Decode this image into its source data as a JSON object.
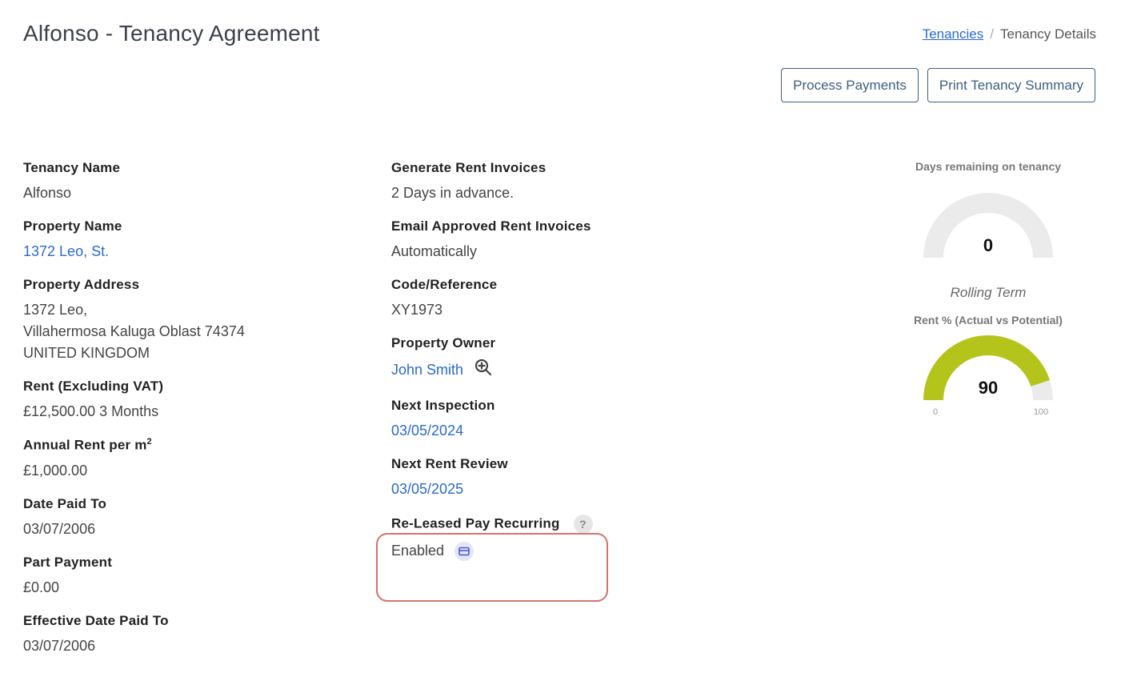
{
  "header": {
    "title": "Alfonso - Tenancy Agreement",
    "breadcrumb": {
      "link": "Tenancies",
      "separator": "/",
      "current": "Tenancy Details"
    }
  },
  "actions": {
    "process_payments": "Process Payments",
    "print_summary": "Print Tenancy Summary"
  },
  "left": {
    "tenancy_name": {
      "label": "Tenancy Name",
      "value": "Alfonso"
    },
    "property_name": {
      "label": "Property Name",
      "value": "1372 Leo, St."
    },
    "property_address": {
      "label": "Property Address",
      "line1": "1372 Leo,",
      "line2": "Villahermosa Kaluga Oblast 74374",
      "line3": "UNITED KINGDOM"
    },
    "rent": {
      "label": "Rent (Excluding VAT)",
      "value": "£12,500.00 3 Months"
    },
    "annual_rent": {
      "label": "Annual Rent per m",
      "sup": "2",
      "value": "£1,000.00"
    },
    "date_paid_to": {
      "label": "Date Paid To",
      "value": "03/07/2006"
    },
    "part_payment": {
      "label": "Part Payment",
      "value": "£0.00"
    },
    "effective_date": {
      "label": "Effective Date Paid To",
      "value": "03/07/2006"
    }
  },
  "middle": {
    "generate_invoices": {
      "label": "Generate Rent Invoices",
      "value": "2 Days in advance."
    },
    "email_invoices": {
      "label": "Email Approved Rent Invoices",
      "value": "Automatically"
    },
    "code": {
      "label": "Code/Reference",
      "value": "XY1973"
    },
    "owner": {
      "label": "Property Owner",
      "value": "John Smith"
    },
    "next_inspection": {
      "label": "Next Inspection",
      "value": "03/05/2024"
    },
    "next_review": {
      "label": "Next Rent Review",
      "value": "03/05/2025"
    },
    "recurring": {
      "label": "Re-Leased Pay Recurring",
      "value": "Enabled",
      "help": "?"
    }
  },
  "gauges": {
    "days": {
      "title": "Days remaining on tenancy",
      "value": "0",
      "fraction": 0,
      "subtitle": "Rolling Term"
    },
    "rent": {
      "title": "Rent % (Actual vs Potential)",
      "value": "90",
      "fraction": 0.9,
      "min": "0",
      "max": "100"
    }
  },
  "colors": {
    "link": "#2a6acb",
    "gauge_fill": "#b5c41a",
    "gauge_track": "#ebebeb",
    "highlight": "#d4736a"
  }
}
